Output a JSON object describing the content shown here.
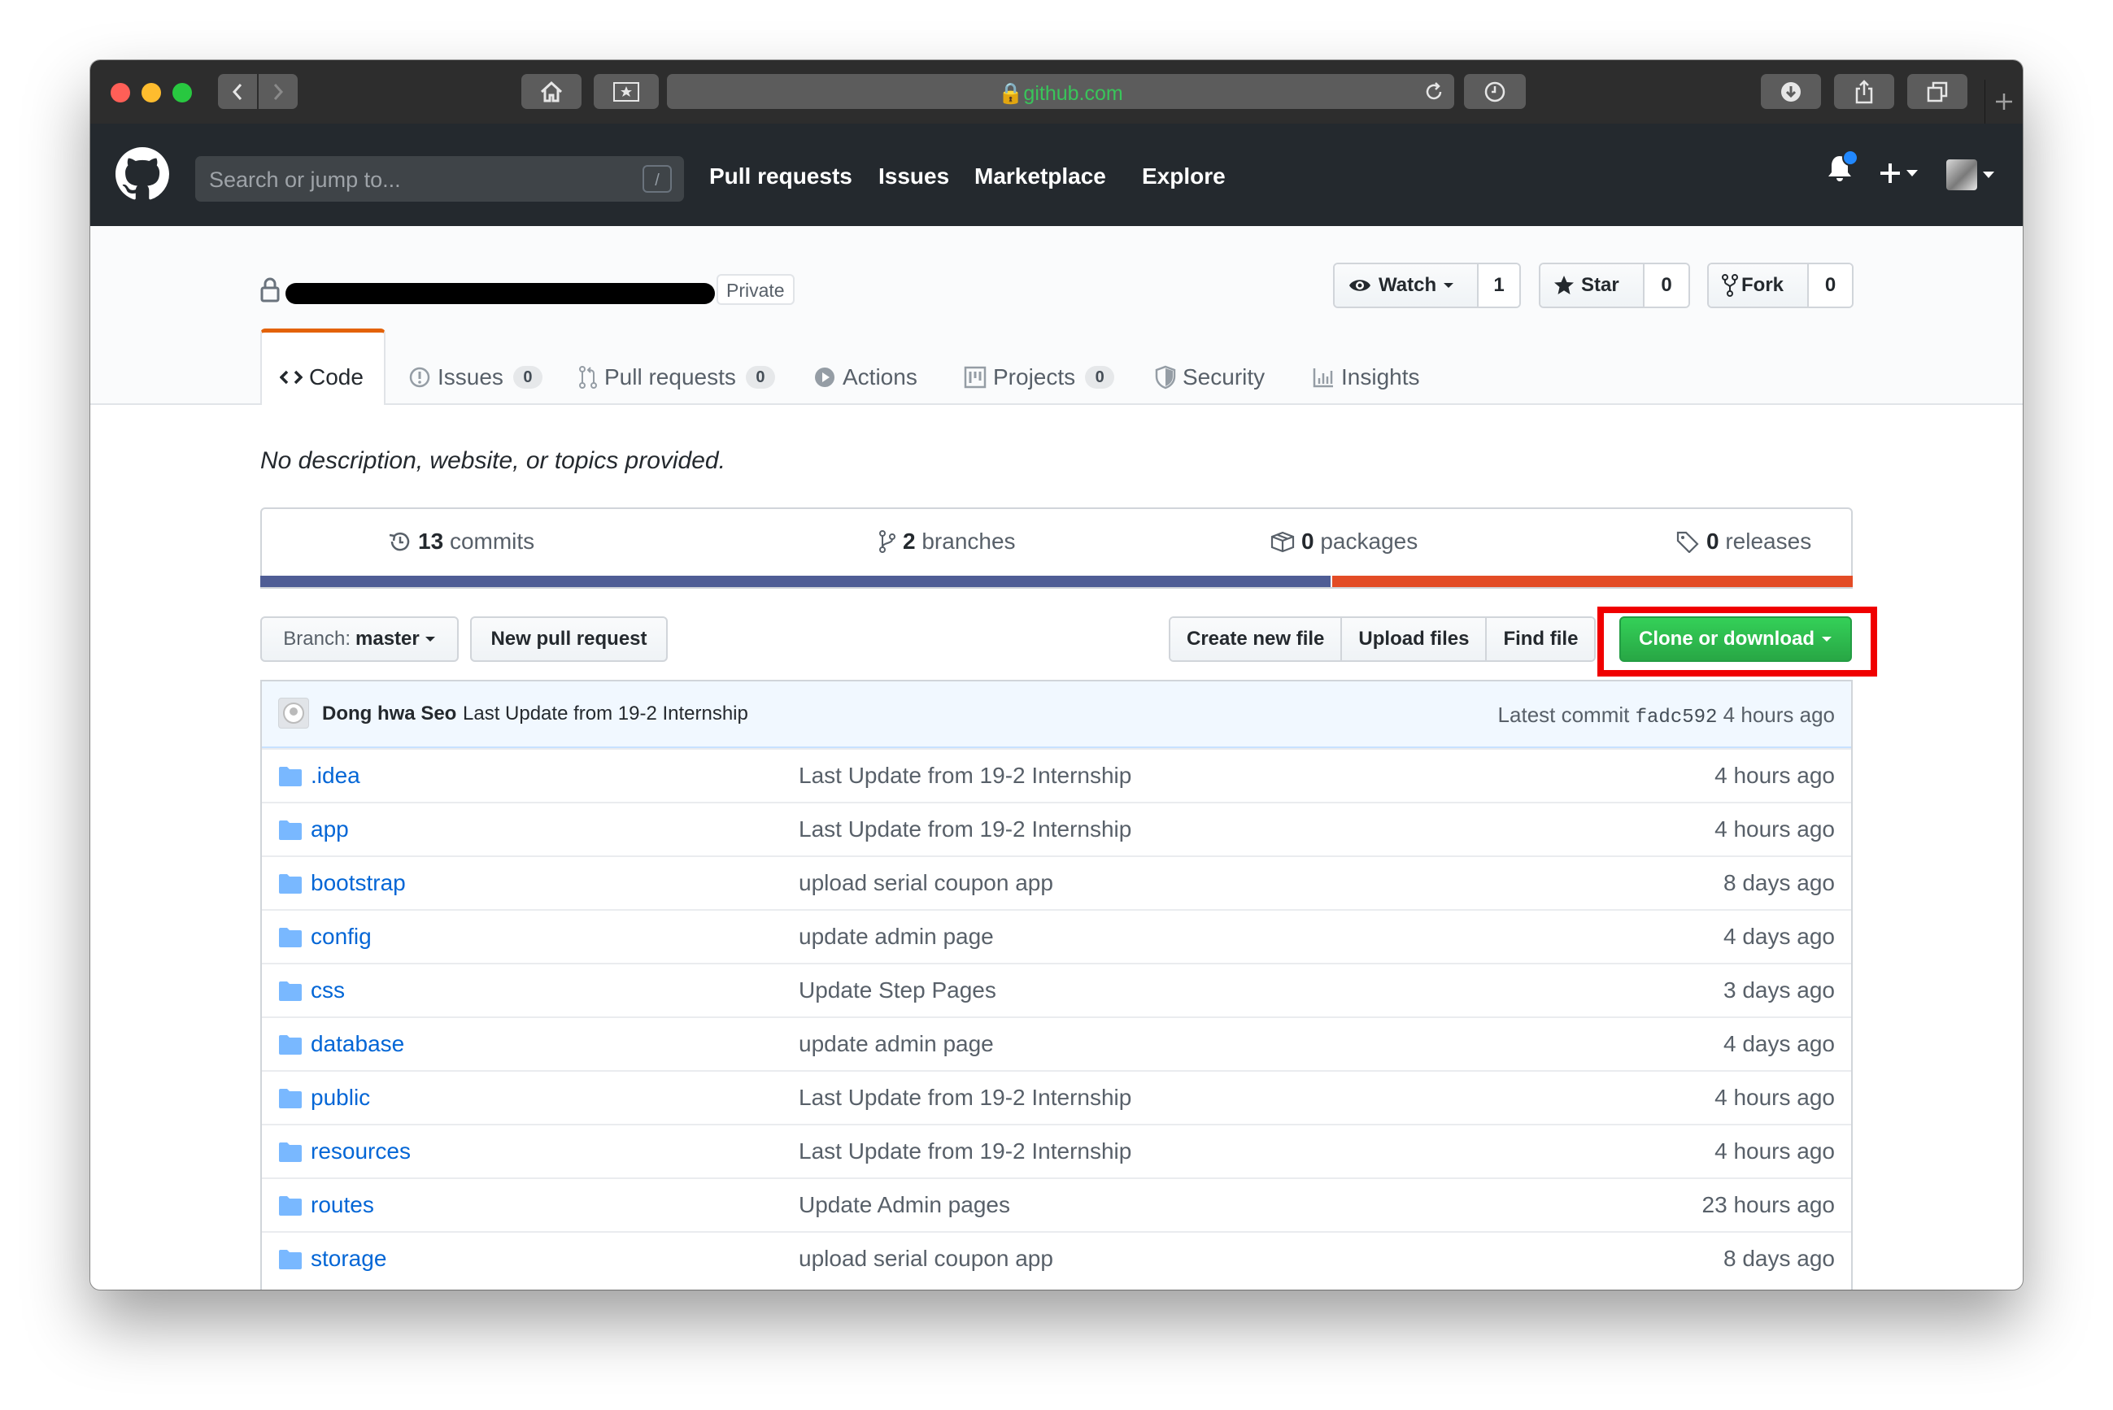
{
  "browser": {
    "url": "github.com"
  },
  "header": {
    "search_placeholder": "Search or jump to...",
    "search_shortcut": "/",
    "nav": [
      "Pull requests",
      "Issues",
      "Marketplace",
      "Explore"
    ]
  },
  "repo": {
    "visibility": "Private",
    "watch": {
      "label": "Watch",
      "count": "1"
    },
    "star": {
      "label": "Star",
      "count": "0"
    },
    "fork": {
      "label": "Fork",
      "count": "0"
    },
    "tabs": [
      {
        "label": "Code"
      },
      {
        "label": "Issues",
        "count": "0"
      },
      {
        "label": "Pull requests",
        "count": "0"
      },
      {
        "label": "Actions"
      },
      {
        "label": "Projects",
        "count": "0"
      },
      {
        "label": "Security"
      },
      {
        "label": "Insights"
      }
    ]
  },
  "main": {
    "description": "No description, website, or topics provided.",
    "summary": {
      "commits_count": "13",
      "commits_label": "commits",
      "branches_count": "2",
      "branches_label": "branches",
      "packages_count": "0",
      "packages_label": "packages",
      "releases_count": "0",
      "releases_label": "releases"
    },
    "languages": [
      {
        "color": "#4f5d95",
        "share": 0.673
      },
      {
        "color": "#e34c26",
        "share": 0.327
      }
    ],
    "branch_prefix": "Branch:",
    "branch_name": "master",
    "new_pr": "New pull request",
    "create_file": "Create new file",
    "upload_files": "Upload files",
    "find_file": "Find file",
    "clone": "Clone or download"
  },
  "commit": {
    "author": "Dong hwa Seo",
    "message": "Last Update from 19-2 Internship",
    "latest_label": "Latest commit",
    "sha": "fadc592",
    "age": "4 hours ago"
  },
  "files": [
    {
      "name": ".idea",
      "message": "Last Update from 19-2 Internship",
      "age": "4 hours ago"
    },
    {
      "name": "app",
      "message": "Last Update from 19-2 Internship",
      "age": "4 hours ago"
    },
    {
      "name": "bootstrap",
      "message": "upload serial coupon app",
      "age": "8 days ago"
    },
    {
      "name": "config",
      "message": "update admin page",
      "age": "4 days ago"
    },
    {
      "name": "css",
      "message": "Update Step Pages",
      "age": "3 days ago"
    },
    {
      "name": "database",
      "message": "update admin page",
      "age": "4 days ago"
    },
    {
      "name": "public",
      "message": "Last Update from 19-2 Internship",
      "age": "4 hours ago"
    },
    {
      "name": "resources",
      "message": "Last Update from 19-2 Internship",
      "age": "4 hours ago"
    },
    {
      "name": "routes",
      "message": "Update Admin pages",
      "age": "23 hours ago"
    },
    {
      "name": "storage",
      "message": "upload serial coupon app",
      "age": "8 days ago"
    }
  ]
}
